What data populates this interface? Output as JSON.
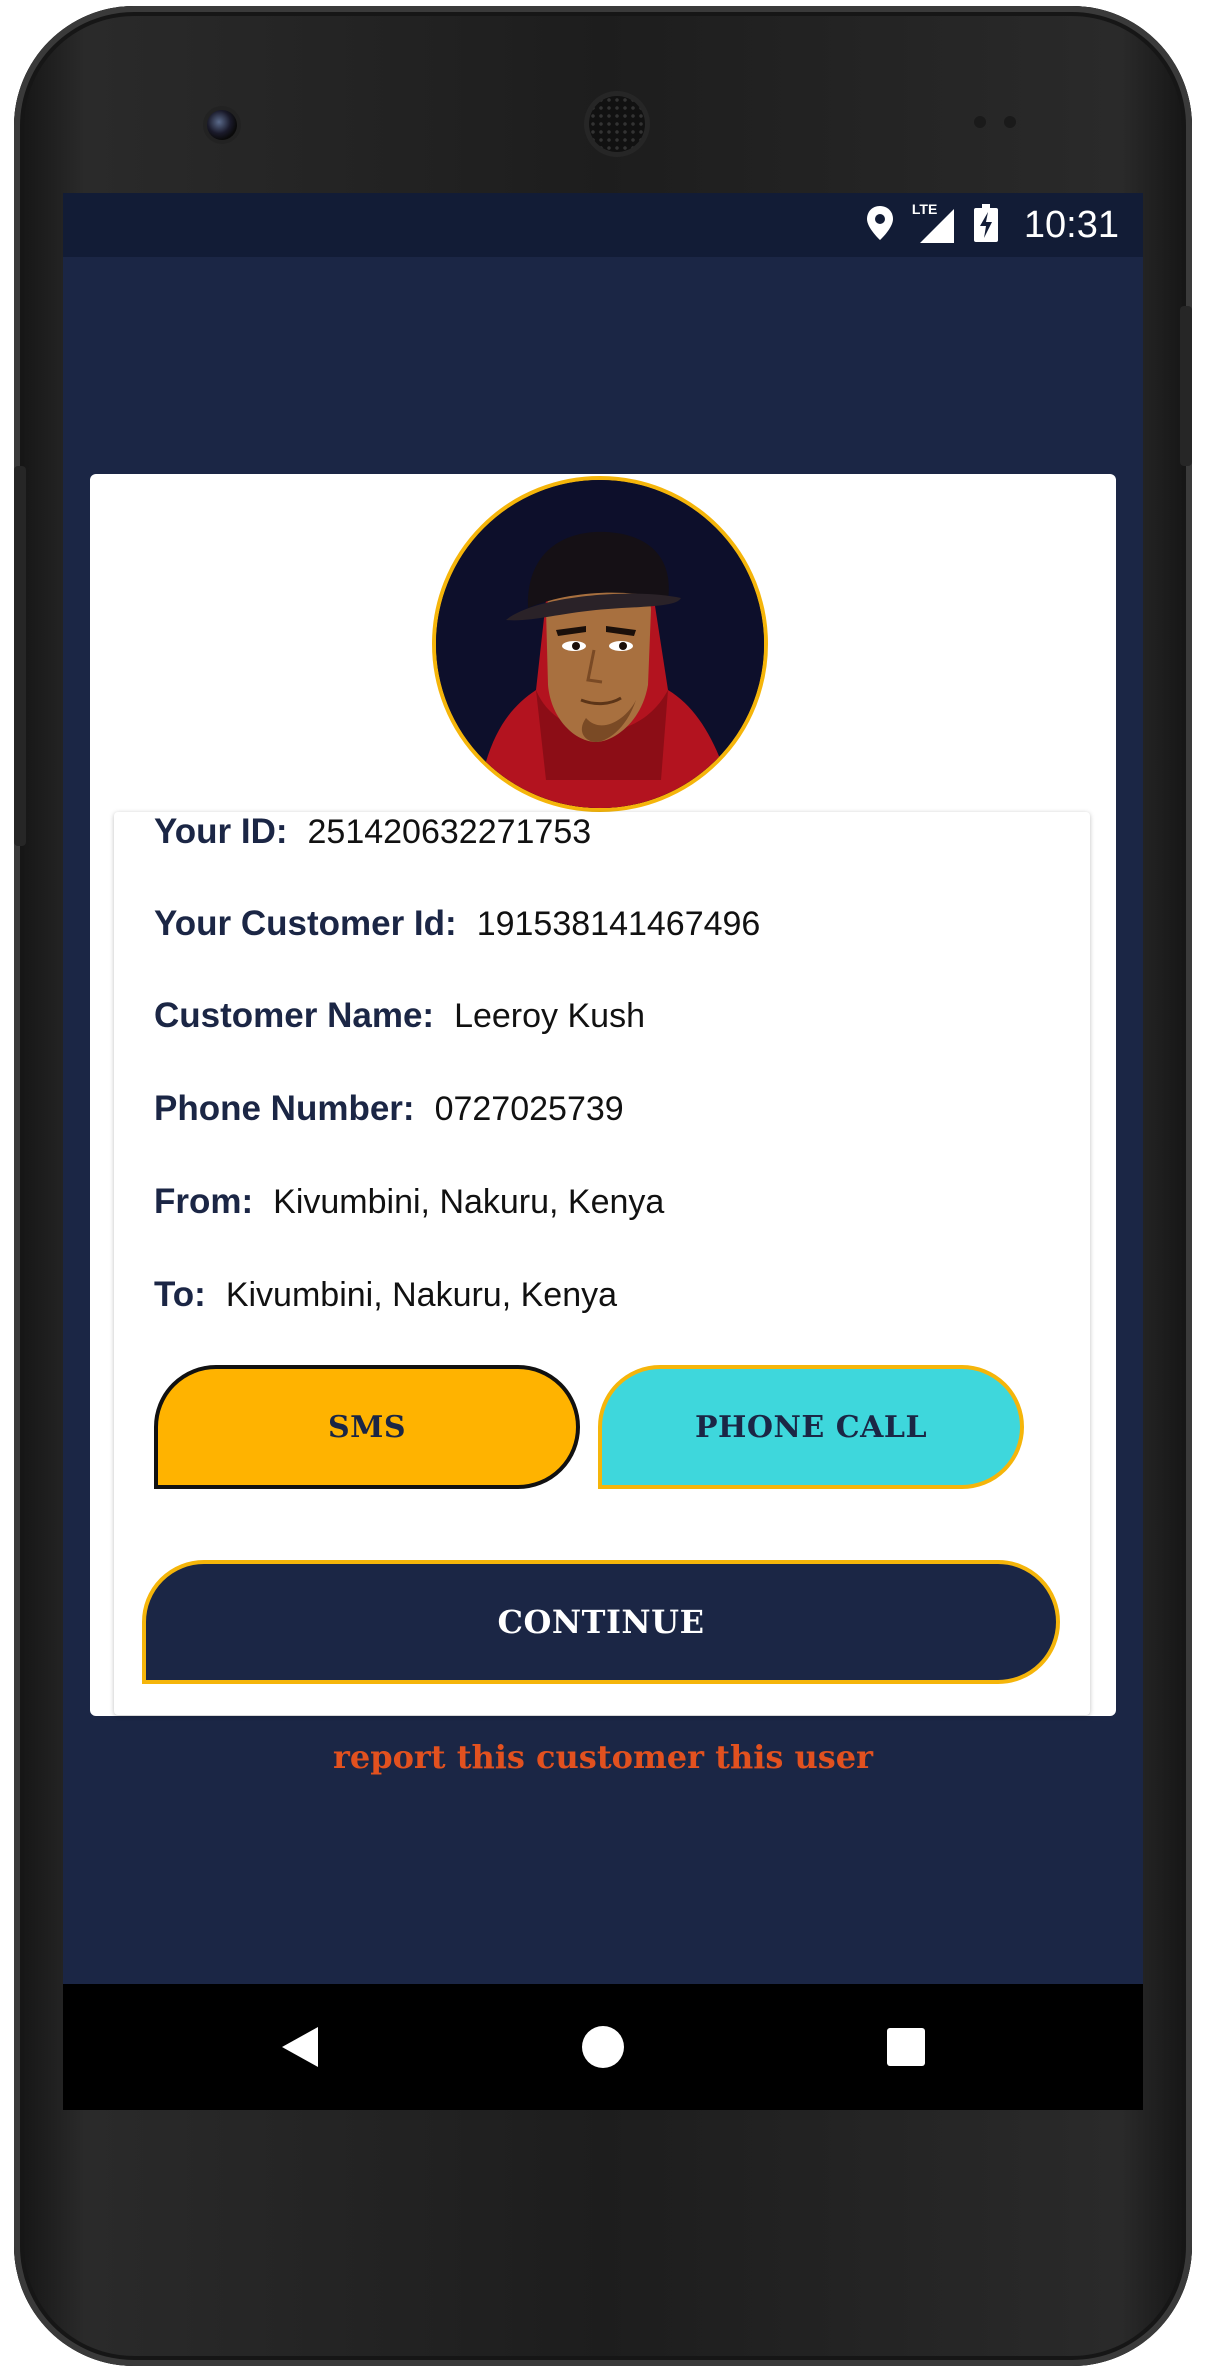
{
  "status_bar": {
    "time": "10:31",
    "network": "LTE",
    "icons": [
      "location-icon",
      "signal-icon",
      "battery-charging-icon"
    ]
  },
  "profile": {
    "avatar": "avatar-hooded-man"
  },
  "details": [
    {
      "label": "Your ID:",
      "value": "251420632271753"
    },
    {
      "label": "Your Customer Id:",
      "value": "191538141467496"
    },
    {
      "label": "Customer Name:",
      "value": "Leeroy Kush"
    },
    {
      "label": "Phone Number:",
      "value": "0727025739"
    },
    {
      "label": "From:",
      "value": "Kivumbini, Nakuru, Kenya"
    },
    {
      "label": "To:",
      "value": "Kivumbini, Nakuru, Kenya"
    }
  ],
  "actions": {
    "sms_label": "SMS",
    "call_label": "PHONE CALL",
    "continue_label": "CONTINUE"
  },
  "report_link": "report this customer this user",
  "nav": {
    "icons": [
      "back-icon",
      "home-icon",
      "recents-icon"
    ]
  },
  "colors": {
    "primary": "#1b2645",
    "accent_yellow": "#ffb300",
    "accent_cyan": "#3ed7dc",
    "border_gold": "#f5b50a",
    "report": "#e2511f"
  }
}
